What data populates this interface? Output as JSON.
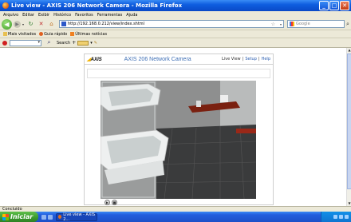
{
  "window": {
    "title": "Live view - AXIS 206 Network Camera - Mozilla Firefox",
    "controls": {
      "minimize": "_",
      "maximize": "□",
      "close": "✕"
    }
  },
  "menu": [
    "Arquivo",
    "Editar",
    "Exibir",
    "Histórico",
    "Favoritos",
    "Ferramentas",
    "Ajuda"
  ],
  "navbar": {
    "url": "http://192.168.0.212/view/index.shtml",
    "search_placeholder": "Google"
  },
  "bookmarks": [
    {
      "label": "Mais visitados"
    },
    {
      "label": "Guia rápido"
    },
    {
      "label": "Últimas notícias"
    }
  ],
  "extrabar": {
    "search_label": "Search"
  },
  "camera_page": {
    "logo": "AXIS",
    "title": "AXIS 206 Network Camera",
    "links": {
      "live_view": "Live View",
      "sep1": "|",
      "setup": "Setup",
      "sep2": "|",
      "help": "Help"
    }
  },
  "statusbar": {
    "text": "Concluído"
  },
  "taskbar": {
    "start_label": "Iniciar",
    "task_label": "Live view - AXIS 2...",
    "clock": ""
  },
  "colors": {
    "titlebar": "#0a49c6",
    "camera_title": "#3e6fb5",
    "start_green": "#3a9a2c"
  }
}
